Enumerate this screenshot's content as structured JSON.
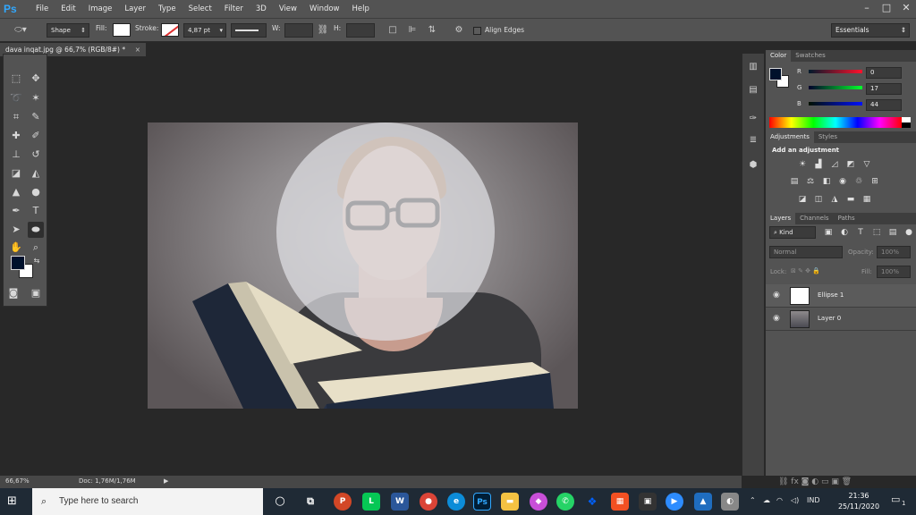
{
  "app": {
    "logo": "Ps"
  },
  "menu": [
    "File",
    "Edit",
    "Image",
    "Layer",
    "Type",
    "Select",
    "Filter",
    "3D",
    "View",
    "Window",
    "Help"
  ],
  "window_controls": [
    "–",
    "□",
    "✕"
  ],
  "options_bar": {
    "mode": "Shape",
    "fill_label": "Fill:",
    "stroke_label": "Stroke:",
    "stroke_width": "4,87 pt",
    "w_label": "W:",
    "h_label": "H:",
    "align_edges": "Align Edges",
    "workspace": "Essentials"
  },
  "document": {
    "tab_title": "dava inqat.jpg @ 66,7% (RGB/8#) *",
    "close": "×"
  },
  "status": {
    "zoom": "66,67%",
    "doc": "Doc: 1,76M/1,76M"
  },
  "colors": {
    "foreground": "#00112c",
    "background": "#ffffff",
    "ps_blue": "#31a8ff"
  },
  "color_panel": {
    "tabs": [
      "Color",
      "Swatches"
    ],
    "channels": [
      {
        "label": "R",
        "value": "0"
      },
      {
        "label": "G",
        "value": "17"
      },
      {
        "label": "B",
        "value": "44"
      }
    ]
  },
  "adjustments_panel": {
    "tabs": [
      "Adjustments",
      "Styles"
    ],
    "heading": "Add an adjustment"
  },
  "layers_panel": {
    "tabs": [
      "Layers",
      "Channels",
      "Paths"
    ],
    "kind": "Kind",
    "blend_mode": "Normal",
    "opacity_label": "Opacity:",
    "opacity_value": "100%",
    "lock_label": "Lock:",
    "fill_label": "Fill:",
    "fill_value": "100%",
    "layers": [
      {
        "name": "Ellipse 1"
      },
      {
        "name": "Layer 0"
      }
    ]
  },
  "taskbar": {
    "search_placeholder": "Type here to search",
    "lang": "IND",
    "time": "21:36",
    "date": "25/11/2020",
    "notif_count": "1"
  }
}
